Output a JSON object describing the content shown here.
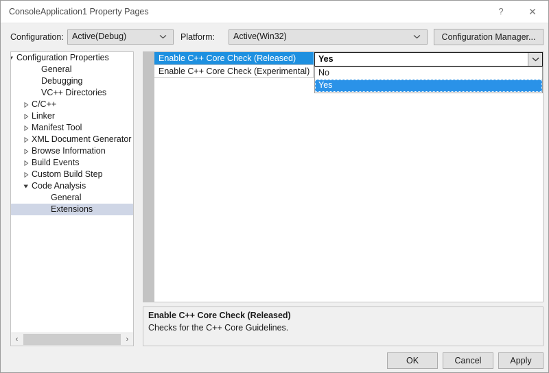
{
  "window": {
    "title": "ConsoleApplication1 Property Pages",
    "help_glyph": "?",
    "close_glyph": "✕"
  },
  "toolbar": {
    "configuration_label": "Configuration:",
    "configuration_value": "Active(Debug)",
    "platform_label": "Platform:",
    "platform_value": "Active(Win32)",
    "configuration_manager_label": "Configuration Manager..."
  },
  "tree": {
    "items": [
      {
        "label": "Configuration Properties",
        "indent": 8,
        "twisty": "expanded",
        "selected": false
      },
      {
        "label": "General",
        "indent": 44,
        "twisty": "none",
        "selected": false
      },
      {
        "label": "Debugging",
        "indent": 44,
        "twisty": "none",
        "selected": false
      },
      {
        "label": "VC++ Directories",
        "indent": 44,
        "twisty": "none",
        "selected": false
      },
      {
        "label": "C/C++",
        "indent": 30,
        "twisty": "collapsed",
        "selected": false
      },
      {
        "label": "Linker",
        "indent": 30,
        "twisty": "collapsed",
        "selected": false
      },
      {
        "label": "Manifest Tool",
        "indent": 30,
        "twisty": "collapsed",
        "selected": false
      },
      {
        "label": "XML Document Generator",
        "indent": 30,
        "twisty": "collapsed",
        "selected": false
      },
      {
        "label": "Browse Information",
        "indent": 30,
        "twisty": "collapsed",
        "selected": false
      },
      {
        "label": "Build Events",
        "indent": 30,
        "twisty": "collapsed",
        "selected": false
      },
      {
        "label": "Custom Build Step",
        "indent": 30,
        "twisty": "collapsed",
        "selected": false
      },
      {
        "label": "Code Analysis",
        "indent": 30,
        "twisty": "expanded",
        "selected": false
      },
      {
        "label": "General",
        "indent": 58,
        "twisty": "none",
        "selected": false
      },
      {
        "label": "Extensions",
        "indent": 58,
        "twisty": "none",
        "selected": true
      }
    ],
    "scroll_left_glyph": "‹",
    "scroll_right_glyph": "›"
  },
  "grid": {
    "rows": [
      {
        "name": "Enable C++ Core Check (Released)",
        "value": "Yes",
        "selected": true
      },
      {
        "name": "Enable C++ Core Check (Experimental)",
        "value": "",
        "selected": false
      }
    ],
    "editor": {
      "value": "Yes",
      "options": [
        {
          "label": "No",
          "highlighted": false
        },
        {
          "label": "Yes",
          "highlighted": true
        }
      ]
    }
  },
  "description": {
    "title": "Enable C++ Core Check (Released)",
    "text": "Checks for the C++ Core Guidelines."
  },
  "footer": {
    "ok_label": "OK",
    "cancel_label": "Cancel",
    "apply_label": "Apply"
  },
  "colors": {
    "selection_blue": "#1e90e0",
    "dropdown_highlight": "#2a92e8",
    "tree_selection": "#cfd6e6",
    "dialog_face": "#f0f0f0",
    "gutter": "#c3c3c3"
  }
}
